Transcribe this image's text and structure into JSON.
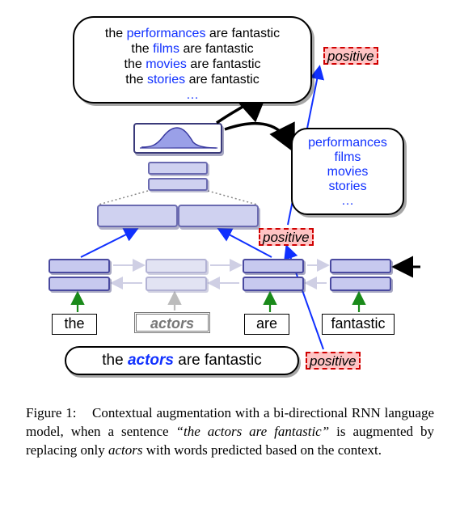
{
  "augmented_sentences": {
    "prefix": "the",
    "suffix": "are fantastic",
    "words": [
      "performances",
      "films",
      "movies",
      "stories"
    ],
    "ellipsis": "…"
  },
  "predicted_words": {
    "words": [
      "performances",
      "films",
      "movies",
      "stories"
    ],
    "ellipsis": "…"
  },
  "labels": {
    "positive": "positive"
  },
  "tokens": {
    "the": "the",
    "actors": "actors",
    "are": "are",
    "fantastic": "fantastic"
  },
  "sentence": {
    "prefix": "the ",
    "target": "actors",
    "suffix": " are fantastic"
  },
  "caption": {
    "fig_label": "Figure 1:",
    "body1": "Contextual augmentation with a bi-directional RNN language model, when a sentence",
    "quoted": "“the actors are fantastic”",
    "body2": "is augmented by replacing only",
    "italic_word": "actors",
    "body3": "with words predicted based on the context."
  }
}
